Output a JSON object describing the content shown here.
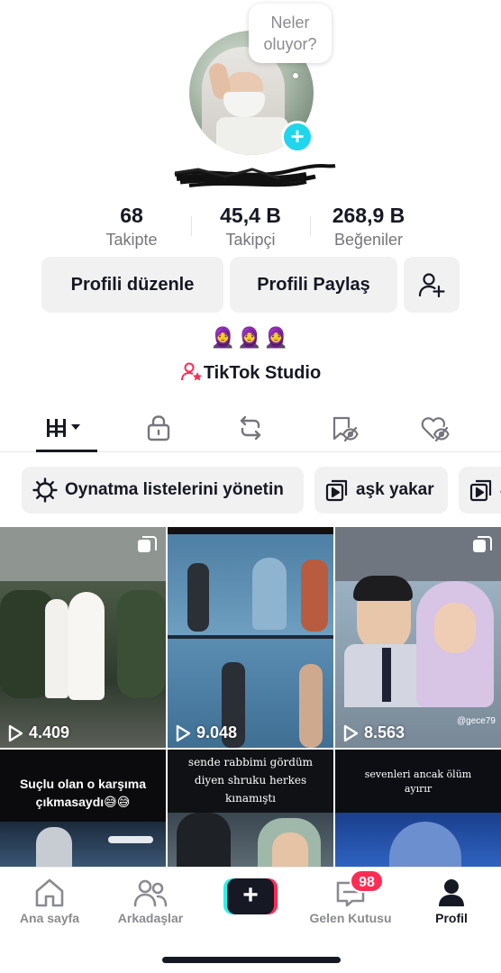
{
  "profile": {
    "bubble_text_line1": "Neler",
    "bubble_text_line2": "oluyor?",
    "add_badge": "+",
    "stats": [
      {
        "value": "68",
        "label": "Takipte"
      },
      {
        "value": "45,4 B",
        "label": "Takipçi"
      },
      {
        "value": "268,9 B",
        "label": "Beğeniler"
      }
    ],
    "edit_button": "Profili düzenle",
    "share_button": "Profili Paylaş",
    "bio_emojis": "🧕🧕🧕",
    "studio_link": "TikTok Studio"
  },
  "tabs": [
    {
      "name": "videos",
      "icon": "grid-icon",
      "active": true
    },
    {
      "name": "private",
      "icon": "lock-icon"
    },
    {
      "name": "reposts",
      "icon": "repost-icon"
    },
    {
      "name": "favorites",
      "icon": "bookmark-eye-icon"
    },
    {
      "name": "liked",
      "icon": "heart-eye-icon"
    }
  ],
  "chips": [
    {
      "label": "Oynatma listelerini yönetin",
      "icon": "gear-icon"
    },
    {
      "label": "aşk yakar",
      "icon": "playlist-icon"
    },
    {
      "label": "a",
      "icon": "playlist-icon"
    }
  ],
  "videos": [
    {
      "views": "4.409",
      "multi": true
    },
    {
      "views": "9.048",
      "multi": false
    },
    {
      "views": "8.563",
      "multi": true,
      "watermark": "@gece79"
    },
    {
      "caption": "Suçlu olan o karşıma çıkmasaydı😅😅"
    },
    {
      "caption_line1": "sende rabbimi gördüm",
      "caption_line2": "diyen shruku herkes",
      "caption_line3": "kınamıştı"
    },
    {
      "caption_line1": "sevenleri ancak ölüm",
      "caption_line2": "ayırır"
    }
  ],
  "nav": {
    "home": "Ana sayfa",
    "friends": "Arkadaşlar",
    "create": "+",
    "inbox": "Gelen Kutusu",
    "inbox_badge": "98",
    "profile": "Profil"
  }
}
